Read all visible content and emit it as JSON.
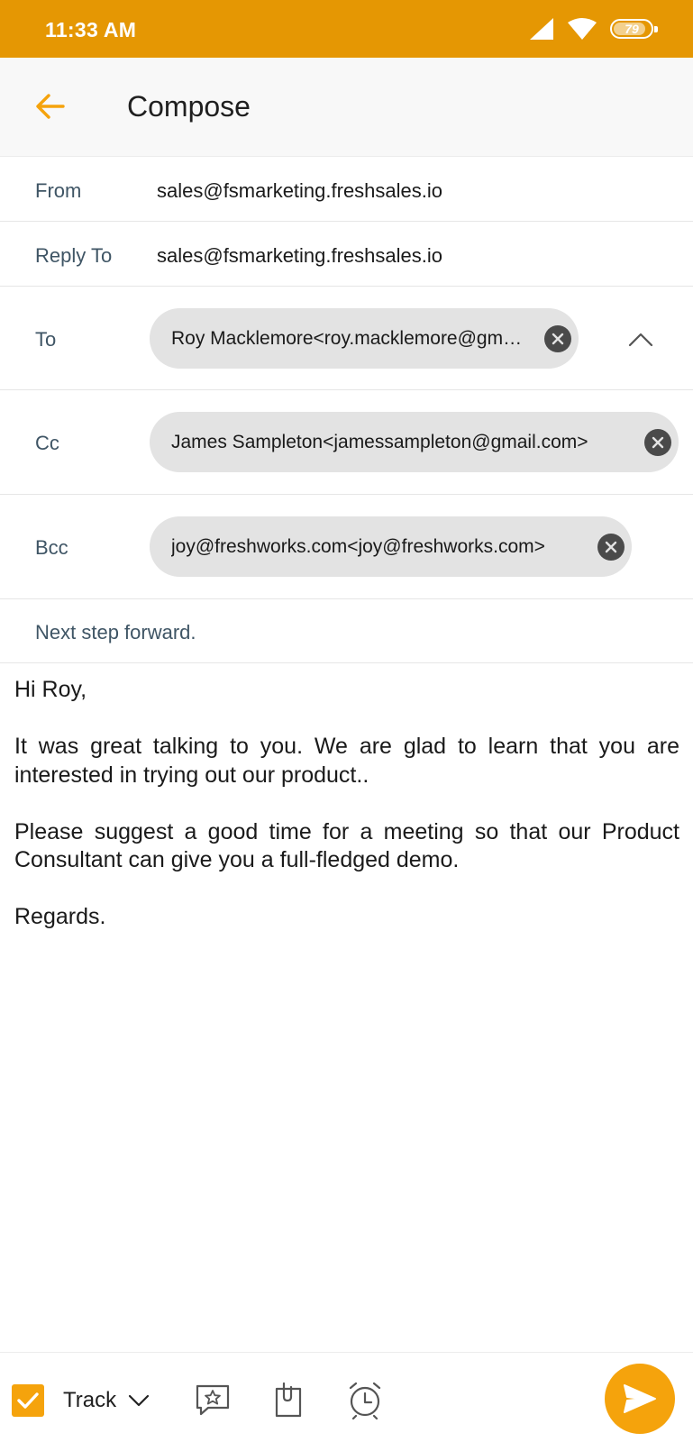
{
  "status_bar": {
    "time": "11:33 AM",
    "battery": "79",
    "icons": [
      "signal-icon",
      "wifi-icon",
      "battery-icon"
    ]
  },
  "app_bar": {
    "title": "Compose",
    "back_icon": "arrow-left-icon"
  },
  "form": {
    "from": {
      "label": "From",
      "value": "sales@fsmarketing.freshsales.io"
    },
    "reply_to": {
      "label": "Reply To",
      "value": "sales@fsmarketing.freshsales.io"
    },
    "to": {
      "label": "To",
      "chip": "Roy Macklemore<roy.macklemore@gmail.com>"
    },
    "cc": {
      "label": "Cc",
      "chip": "James Sampleton<jamessampleton@gmail.com>"
    },
    "bcc": {
      "label": "Bcc",
      "chip": "joy@freshworks.com<joy@freshworks.com>"
    },
    "subject": "Next step forward."
  },
  "body": {
    "greeting": "Hi Roy,",
    "paragraph1": "It was great talking to you. We are glad to learn that you are interested in trying out our product..",
    "paragraph2": "Please suggest a good time for a meeting so that our Product Consultant can give you a full-fledged demo.",
    "signoff": "Regards."
  },
  "toolbar": {
    "track_label": "Track",
    "track_checked": true,
    "icons": [
      "template-icon",
      "attachment-icon",
      "schedule-icon",
      "send-icon"
    ]
  },
  "colors": {
    "accent": "#f5a30c",
    "status_bar": "#e59703",
    "label_text": "#3f5565",
    "chip_bg": "#e3e3e3"
  }
}
